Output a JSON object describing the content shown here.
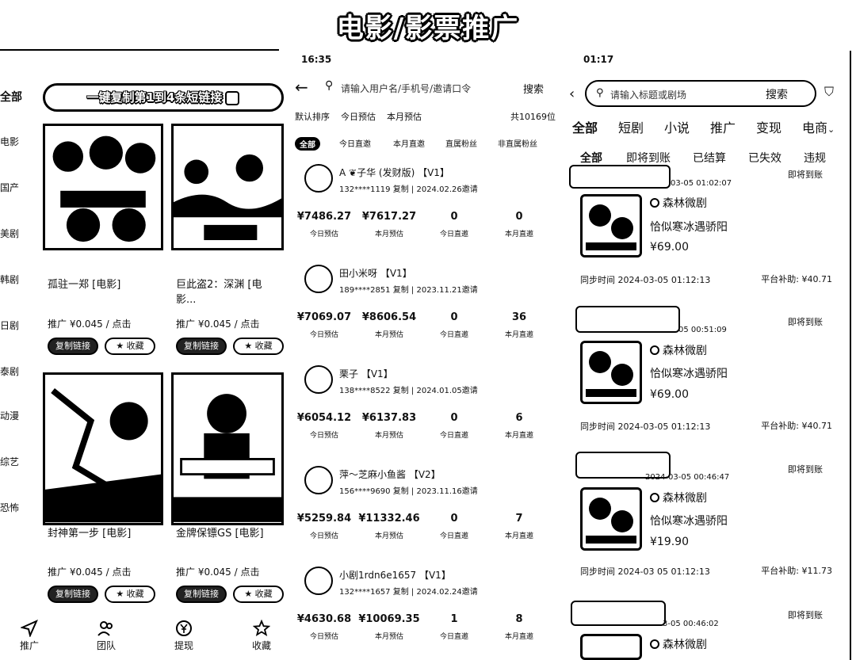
{
  "heading": "电影/影票推广",
  "panel1": {
    "categories": [
      "全部",
      "电影",
      "国产",
      "美剧",
      "韩剧",
      "日剧",
      "泰剧",
      "动漫",
      "综艺",
      "恐怖"
    ],
    "copy_all_label": "一键复制第1到4条短链接",
    "movies": [
      {
        "title": "孤驻一郑 [电影]",
        "promo": "推广 ¥0.045 / 点击"
      },
      {
        "title": "巨此盗2：深渊 [电影...",
        "promo": "推广 ¥0.045 / 点击"
      },
      {
        "title": "封神第一步 [电影]",
        "promo": "推广 ¥0.045 / 点击"
      },
      {
        "title": "金牌保镖GS [电影]",
        "promo": "推广 ¥0.045 / 点击"
      }
    ],
    "copy_link_label": "复制链接",
    "favorite_label": "收藏",
    "nav": [
      "推广",
      "团队",
      "提现",
      "收藏"
    ]
  },
  "panel2": {
    "time": "16:35",
    "search_placeholder": "请输入用户名/手机号/邀请口令",
    "search_btn": "搜索",
    "sort": [
      "默认排序",
      "今日预估",
      "本月预估"
    ],
    "total": "共10169位",
    "filters": [
      "全部",
      "今日直邀",
      "本月直邀",
      "直属粉丝",
      "非直属粉丝"
    ],
    "users": [
      {
        "name": "A ❦子华 (发财版)",
        "level": "V1",
        "phone": "132****1119",
        "copy": "复制",
        "date": "2024.02.26邀请",
        "stats": [
          "¥7486.27",
          "¥7617.27",
          "0",
          "0"
        ],
        "labels": [
          "今日预估",
          "本月预估",
          "今日直邀",
          "本月直邀"
        ]
      },
      {
        "name": "田小米呀",
        "level": "V1",
        "phone": "189****2851",
        "copy": "复制",
        "date": "2023.11.21邀请",
        "stats": [
          "¥7069.07",
          "¥8606.54",
          "0",
          "36"
        ],
        "labels": [
          "今日预估",
          "本月预估",
          "今日直邀",
          "本月直邀"
        ]
      },
      {
        "name": "栗子",
        "level": "V1",
        "phone": "138****8522",
        "copy": "复制",
        "date": "2024.01.05邀请",
        "stats": [
          "¥6054.12",
          "¥6137.83",
          "0",
          "6"
        ],
        "labels": [
          "今日预估",
          "本月预估",
          "今日直邀",
          "本月直邀"
        ]
      },
      {
        "name": "萍～芝麻小鱼酱",
        "level": "V2",
        "phone": "156****9690",
        "copy": "复制",
        "date": "2023.11.16邀请",
        "stats": [
          "¥5259.84",
          "¥11332.46",
          "0",
          "7"
        ],
        "labels": [
          "今日预估",
          "本月预估",
          "今日直邀",
          "本月直邀"
        ]
      },
      {
        "name": "小剧1rdn6e1657",
        "level": "V1",
        "phone": "132****1657",
        "copy": "复制",
        "date": "2024.02.24邀请",
        "stats": [
          "¥4630.68",
          "¥10069.35",
          "1",
          "8"
        ],
        "labels": [
          "今日预估",
          "本月预估",
          "今日直邀",
          "本月直邀"
        ]
      }
    ]
  },
  "panel3": {
    "time": "01:17",
    "search_placeholder": "请输入标题或剧场",
    "search_btn": "搜索",
    "tabs": [
      "全部",
      "短剧",
      "小说",
      "推广",
      "变现",
      "电商"
    ],
    "subtabs": [
      "全部",
      "即将到账",
      "已结算",
      "已失效",
      "违规"
    ],
    "orders": [
      {
        "time": "03-05 01:02:07",
        "status": "即将到账",
        "shop": "森林微剧",
        "drama": "恰似寒冰遇骄阳",
        "price": "¥69.00",
        "sync": "同步时间 2024-03-05 01:12:13",
        "subsidy": "平台补助: ¥40.71"
      },
      {
        "time": "05 00:51:09",
        "status": "即将到账",
        "shop": "森林微剧",
        "drama": "恰似寒冰遇骄阳",
        "price": "¥69.00",
        "sync": "同步时间 2024-03-05 01:12:13",
        "subsidy": "平台补助: ¥40.71"
      },
      {
        "time": "2024-03-05 00:46:47",
        "status": "即将到账",
        "shop": "森林微剧",
        "drama": "恰似寒冰遇骄阳",
        "price": "¥19.90",
        "sync": "同步时间 2024-03 05 01:12:13",
        "subsidy": "平台补助: ¥11.73"
      },
      {
        "time": "3-05 00:46:02",
        "status": "即将到账",
        "shop": "森林微剧"
      }
    ]
  }
}
